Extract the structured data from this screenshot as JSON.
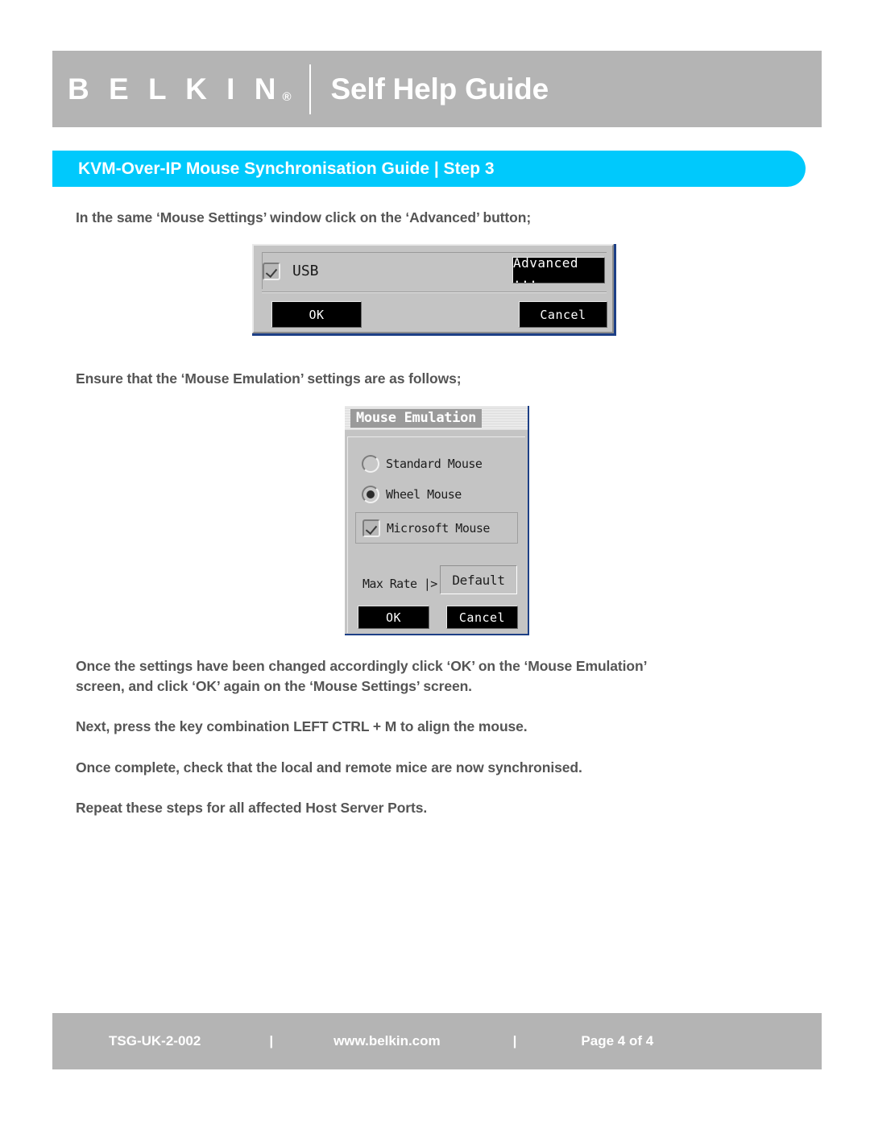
{
  "header": {
    "brand": "B E L K I N",
    "brand_registered": "®",
    "title": "Self Help Guide"
  },
  "banner": {
    "text": "KVM-Over-IP Mouse Synchronisation Guide | Step 3"
  },
  "content": {
    "paragraph_1": "In the same ‘Mouse Settings’ window click on the ‘Advanced’ button;",
    "paragraph_2": "Ensure that the ‘Mouse Emulation’ settings are as follows;",
    "paragraph_3": "Once the settings have been changed accordingly click ‘OK’ on the ‘Mouse Emulation’\nscreen, and click ‘OK’ again on the ‘Mouse Settings’ screen.",
    "paragraph_4": "Next, press the key combination LEFT CTRL + M to align the mouse.",
    "paragraph_5": "Once complete, check that the local and remote mice are now synchronised.",
    "paragraph_6": "Repeat these steps for all affected Host Server Ports."
  },
  "dialog_usb": {
    "checkbox_label": "USB",
    "checkbox_checked": true,
    "advanced_button": "Advanced ...",
    "ok_button": "OK",
    "cancel_button": "Cancel"
  },
  "dialog_mouse_emulation": {
    "title": "Mouse Emulation",
    "options": [
      {
        "label": "Standard Mouse",
        "type": "radio",
        "selected": false
      },
      {
        "label": "Wheel Mouse",
        "type": "radio",
        "selected": true
      },
      {
        "label": "Microsoft Mouse",
        "type": "checkbox",
        "selected": true
      }
    ],
    "max_rate_label": "Max Rate |>",
    "default_button": "Default",
    "ok_button": "OK",
    "cancel_button": "Cancel"
  },
  "footer": {
    "document_code": "TSG-UK-2-002",
    "separator_1": "|",
    "website": "www.belkin.com",
    "separator_2": "|",
    "page": "Page 4 of 4"
  },
  "colors": {
    "header_gray": "#b4b4b4",
    "banner_blue": "#00c9fc",
    "text_gray": "#555555",
    "dialog_gray": "#c4c4c4",
    "dialog_border_blue": "#1d3f86"
  }
}
